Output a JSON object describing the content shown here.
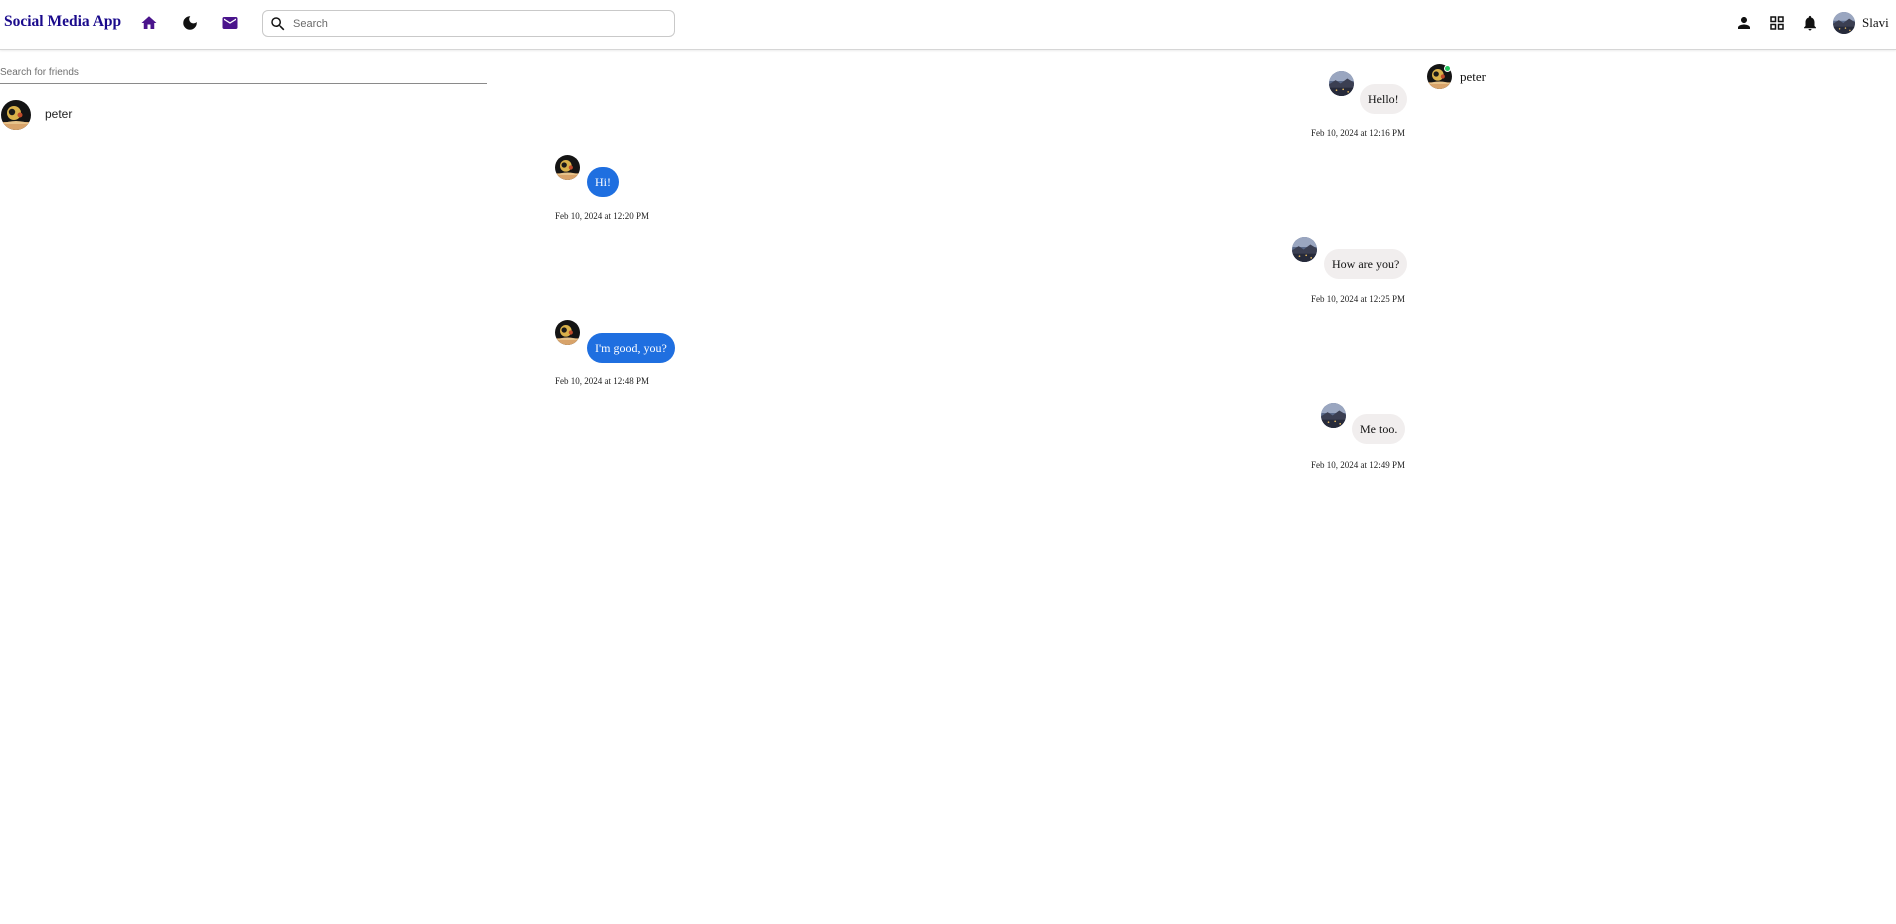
{
  "app": {
    "title": "Social Media App"
  },
  "nav": {
    "search_placeholder": "Search",
    "icons": [
      "home-icon",
      "dark-mode-icon",
      "messages-icon",
      "search-icon",
      "person-icon",
      "grid-apps-icon",
      "notifications-icon"
    ],
    "user_name": "Slavi"
  },
  "colors": {
    "brand": "#1a0a8c",
    "nav_active": "#4a148c",
    "outgoing_bubble": "#f1eeee",
    "incoming_bubble": "#1f6fe0",
    "online": "#22c55e"
  },
  "sidebar": {
    "friend_search_placeholder": "Search for friends",
    "friends": [
      {
        "name": "peter"
      }
    ]
  },
  "chat": {
    "contact_name": "peter",
    "messages": [
      {
        "side": "right",
        "text": "Hello!",
        "time": "Feb 10, 2024 at 12:16 PM"
      },
      {
        "side": "left",
        "text": "Hi!",
        "time": "Feb 10, 2024 at 12:20 PM"
      },
      {
        "side": "right",
        "text": "How are you?",
        "time": "Feb 10, 2024 at 12:25 PM"
      },
      {
        "side": "left",
        "text": "I'm good, you?",
        "time": "Feb 10, 2024 at 12:48 PM"
      },
      {
        "side": "right",
        "text": "Me too.",
        "time": "Feb 10, 2024 at 12:49 PM"
      }
    ]
  }
}
